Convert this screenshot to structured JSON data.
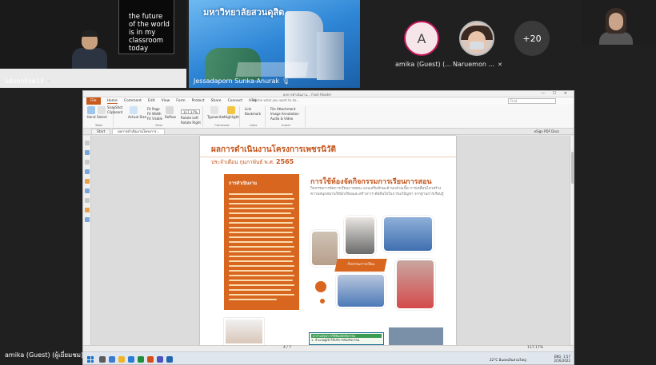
{
  "participants": {
    "host": {
      "name": "sduonline13",
      "board_lines": [
        "the future",
        "of the world",
        "is in my",
        "classroom",
        "today"
      ]
    },
    "presenter": {
      "name": "Jessadaporn Sunka-Anurak",
      "banner": "มหาวิทยาลัยสวนดุสิต"
    },
    "amika": {
      "initial": "A",
      "name": "amika (Guest) (..."
    },
    "naruemon": {
      "name": "Naruemon ..."
    },
    "more": {
      "label": "+20"
    },
    "self": {
      "name": "amika (Guest) (ผู้เยี่ยมชม)"
    }
  },
  "app": {
    "title": "ผลการดำเนินงาน...  Foxit Reader",
    "window_controls": "— ☐ ✕",
    "menu": [
      "File",
      "Home",
      "Comment",
      "Edit",
      "View",
      "Form",
      "Protect",
      "Share",
      "Connect",
      "Help"
    ],
    "help_search": "Tell me what you want to do...",
    "find_placeholder": "Find",
    "ribbon": {
      "hand": "Hand",
      "select": "Select",
      "snapshot": "SnapShot",
      "clipboard": "Clipboard",
      "actual_size": "Actual Size",
      "fit_page": "Fit Page",
      "fit_width": "Fit Width",
      "fit_visible": "Fit Visible",
      "zoom_value": "117.17%",
      "reflow": "Reflow",
      "rotate_left": "Rotate Left",
      "rotate_right": "Rotate Right",
      "typewriter": "Typewriter",
      "highlight": "Highlight",
      "link": "Link",
      "bookmark": "Bookmark",
      "file_attachment": "File Attachment",
      "image_annotation": "Image Annotation",
      "audio_video": "Audio & Video",
      "group_tools": "Tools",
      "group_view": "View",
      "group_comment": "Comment",
      "group_links": "Links",
      "group_insert": "Insert"
    },
    "tabs": [
      "Start",
      "ผลการดำเนินงานโครงการ..."
    ],
    "edge_label": "eSign  PDF Docs",
    "status_page": "4 / 7",
    "status_zoom": "117.17%"
  },
  "document": {
    "title": "ผลการดำเนินงานโครงการเพชรนิวัติ",
    "subtitle_prefix": "ประจำเดือน กุมภาพันธ์ พ.ศ.",
    "subtitle_year": "2565",
    "box_heading": "การดำเนินงาน",
    "right_heading": "การใช้ห้องจัดกิจกรรมการเรียนการสอน",
    "right_text": "กิจกรรมการจัดการเรียนการสอน แบบเสริมทักษะด้านกล้ามเนื้อ การเคลื่อนไหวสร้างความสนุกสนานให้นักเรียนและสร้างการ ตัดสินใจในการแก้ปัญหา จากฐานการเรียนรู้",
    "caption": "กิจกรรมการเรียน",
    "table_header": "ตารางสรุปการใช้ห้องจัดกิจกรรม",
    "table_row": "1. จำนวนผู้เข้าใช้บริการห้องกิจกรรม"
  },
  "taskbar": {
    "weather": "22°C  มีแดดเป็นส่วนใหญ่",
    "lang": "ENG",
    "time": "1:57",
    "date": "2/16/2022"
  }
}
